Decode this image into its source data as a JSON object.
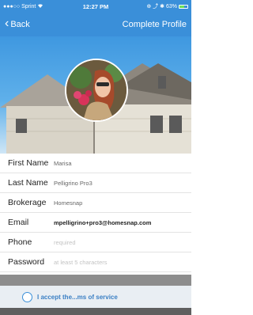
{
  "status_bar": {
    "carrier": "●●●○○ Sprint",
    "wifi_icon": "wifi-icon",
    "time": "12:27 PM",
    "status_icons": "⊕ ⤴ ✱",
    "battery": "63%",
    "battery_level": 0.63,
    "battery_color": "#6be05a"
  },
  "nav": {
    "back_label": "Back",
    "action_label": "Complete Profile",
    "bar_color": "#3a8fd9"
  },
  "form": {
    "fields": [
      {
        "label": "First Name",
        "value": "Marisa"
      },
      {
        "label": "Last Name",
        "value": "Pelligrino Pro3"
      },
      {
        "label": "Brokerage",
        "value": "Homesnap"
      },
      {
        "label": "Email",
        "value": "mpelligrino+pro3@homesnap.com"
      },
      {
        "label": "Phone",
        "placeholder": "required"
      },
      {
        "label": "Password",
        "placeholder": "at least 5 characters"
      }
    ]
  },
  "terms": {
    "label": "I accept the...ms of service"
  }
}
